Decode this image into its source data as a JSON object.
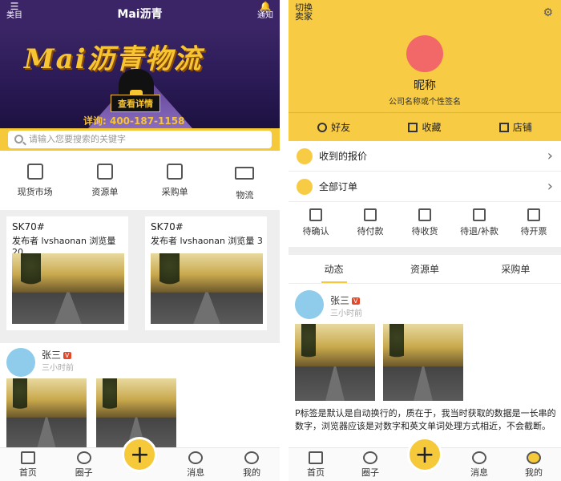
{
  "left": {
    "header": {
      "title": "Mai沥青",
      "menu_label": "类目",
      "notify_label": "通知"
    },
    "banner": {
      "headline": "Mai沥青物流",
      "button": "查看详情",
      "phone": "详询: 400-187-1158"
    },
    "search": {
      "placeholder": "请输入您要搜索的关键字"
    },
    "categories": [
      {
        "label": "现货市场",
        "icon": "calendar-icon"
      },
      {
        "label": "资源单",
        "icon": "list-icon"
      },
      {
        "label": "采购单",
        "icon": "edit-doc-icon"
      },
      {
        "label": "物流",
        "icon": "truck-icon"
      }
    ],
    "cards": [
      {
        "title": "SK70#",
        "publisher": "发布者 lvshaonan",
        "views": "浏览量 20"
      },
      {
        "title": "SK70#",
        "publisher": "发布者 lvshaonan",
        "views": "浏览量 3"
      }
    ],
    "post": {
      "name": "张三",
      "badge": "V",
      "time": "三小时前"
    }
  },
  "right": {
    "switch_label": "切换\n卖家",
    "nickname": "昵称",
    "signature": "公司名称或个性签名",
    "profile_buttons": [
      "好友",
      "收藏",
      "店铺"
    ],
    "list_rows": [
      "收到的报价",
      "全部订单"
    ],
    "order_states": [
      "待确认",
      "待付款",
      "待收货",
      "待退/补款",
      "待开票"
    ],
    "tabs": [
      "动态",
      "资源单",
      "采购单"
    ],
    "post": {
      "name": "张三",
      "badge": "V",
      "time": "三小时前",
      "text": "P标签是默认是自动换行的，质在于，我当时获取的数据是一长串的数字，浏览器应该是对数字和英文单词处理方式相近，不会截断。"
    }
  },
  "tabbar": [
    "首页",
    "圈子",
    "+",
    "消息",
    "我的"
  ],
  "colors": {
    "accent": "#f6c93b",
    "avatar_blue": "#8fcbea",
    "avatar_red": "#f26767",
    "banner_purple": "#3b2566"
  }
}
